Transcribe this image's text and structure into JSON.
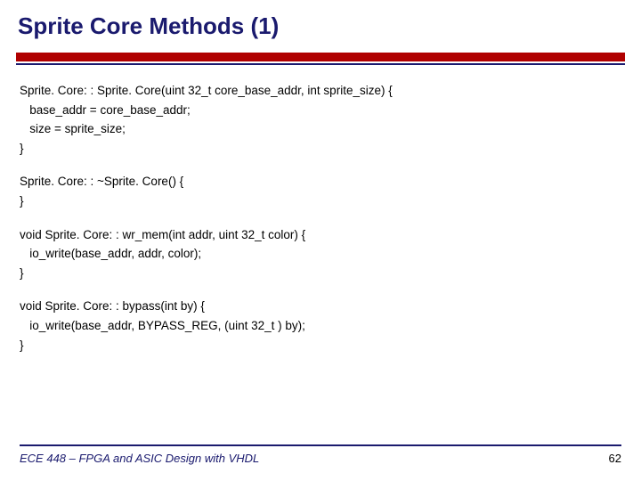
{
  "title": "Sprite Core Methods (1)",
  "code": {
    "block1": "Sprite. Core: : Sprite. Core(uint 32_t core_base_addr, int sprite_size) {\n   base_addr = core_base_addr;\n   size = sprite_size;\n}",
    "block2": "Sprite. Core: : ~Sprite. Core() {\n}",
    "block3": "void Sprite. Core: : wr_mem(int addr, uint 32_t color) {\n   io_write(base_addr, addr, color);\n}",
    "block4": "void Sprite. Core: : bypass(int by) {\n   io_write(base_addr, BYPASS_REG, (uint 32_t ) by);\n}"
  },
  "footer": {
    "course": "ECE 448 – FPGA and ASIC Design with VHDL",
    "page": "62"
  }
}
